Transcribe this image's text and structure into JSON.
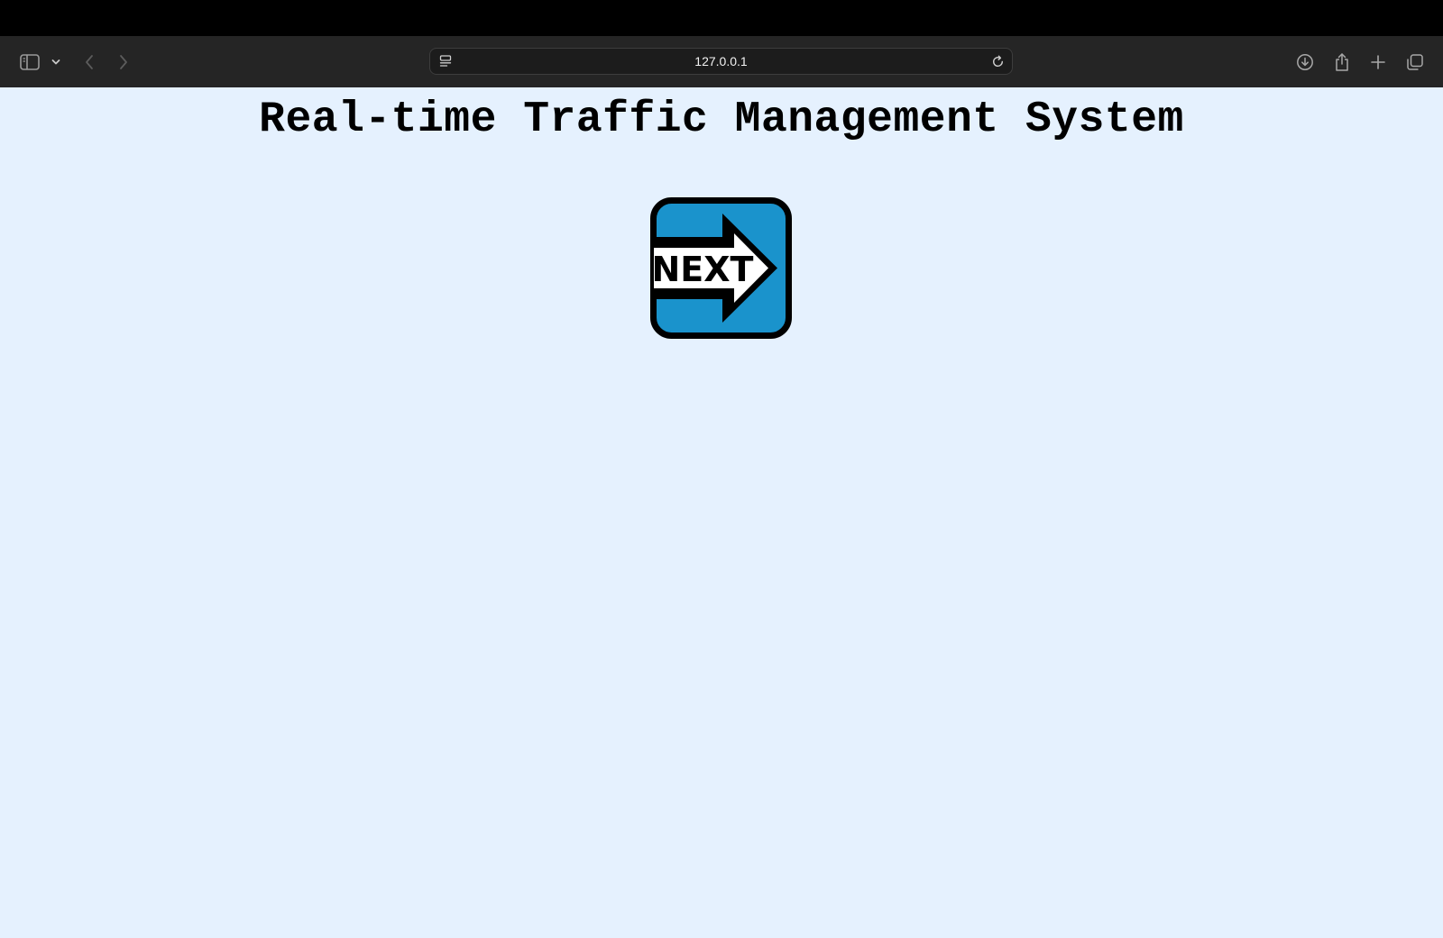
{
  "browser": {
    "url": "127.0.0.1",
    "icons": {
      "sidebar": "sidebar-icon",
      "sidebar_menu": "chevron-down-icon",
      "back": "chevron-left-icon",
      "forward": "chevron-right-icon",
      "site_settings": "page-settings-icon",
      "reload": "reload-icon",
      "downloads": "download-icon",
      "share": "share-icon",
      "new_tab": "plus-icon",
      "tab_overview": "tabs-icon"
    }
  },
  "page": {
    "title": "Real-time Traffic Management System",
    "next_button": {
      "label": "NEXT",
      "icon": "arrow-right-icon",
      "colors": {
        "fill": "#1a93cc",
        "border": "#000000",
        "arrow": "#ffffff"
      }
    },
    "background": "#e5f1fe"
  }
}
